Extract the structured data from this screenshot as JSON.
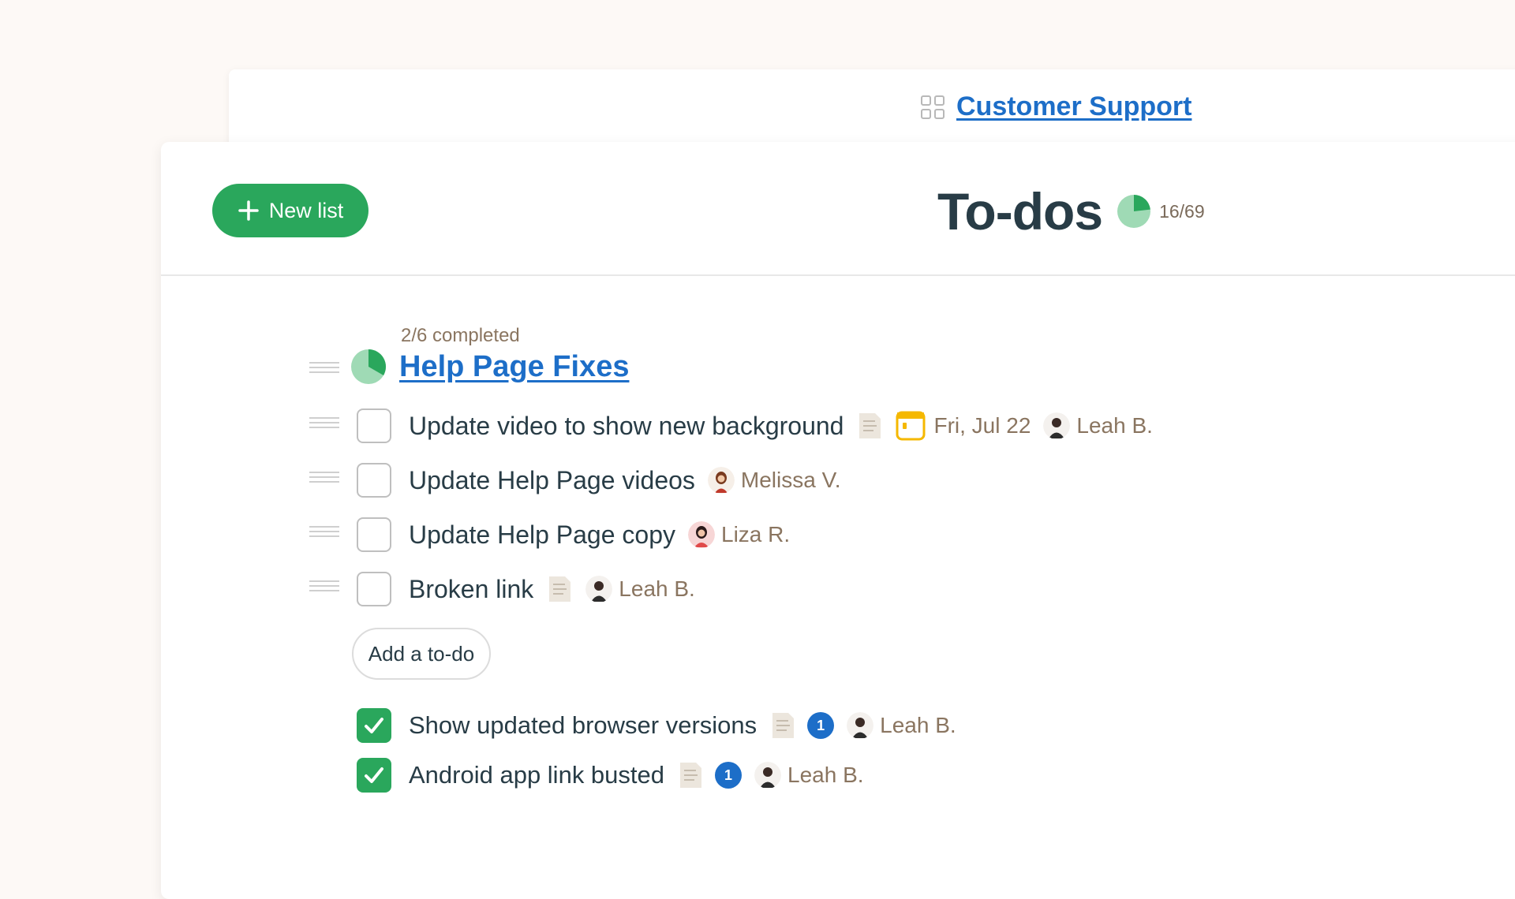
{
  "project": {
    "icon": "grid-icon",
    "name": "Customer Support"
  },
  "header": {
    "new_list_label": "New list",
    "title": "To-dos",
    "progress_text": "16/69",
    "progress_fraction": 0.232,
    "colors": {
      "accent_green": "#2aa75c",
      "link_blue": "#1d6ec8"
    }
  },
  "list": {
    "completed_text": "2/6 completed",
    "progress_fraction": 0.333,
    "title": "Help Page Fixes",
    "todos": [
      {
        "text": "Update video to show new background",
        "has_note": true,
        "due": "Fri, Jul 22",
        "assignee": "Leah B."
      },
      {
        "text": "Update Help Page videos",
        "assignee": "Melissa V."
      },
      {
        "text": "Update Help Page copy",
        "assignee": "Liza R."
      },
      {
        "text": "Broken link",
        "has_note": true,
        "assignee": "Leah B."
      }
    ],
    "add_todo_label": "Add a to-do",
    "completed": [
      {
        "text": "Show updated browser versions",
        "has_note": true,
        "comments": "1",
        "assignee": "Leah B."
      },
      {
        "text": "Android app link busted",
        "has_note": true,
        "comments": "1",
        "assignee": "Leah B."
      }
    ]
  }
}
